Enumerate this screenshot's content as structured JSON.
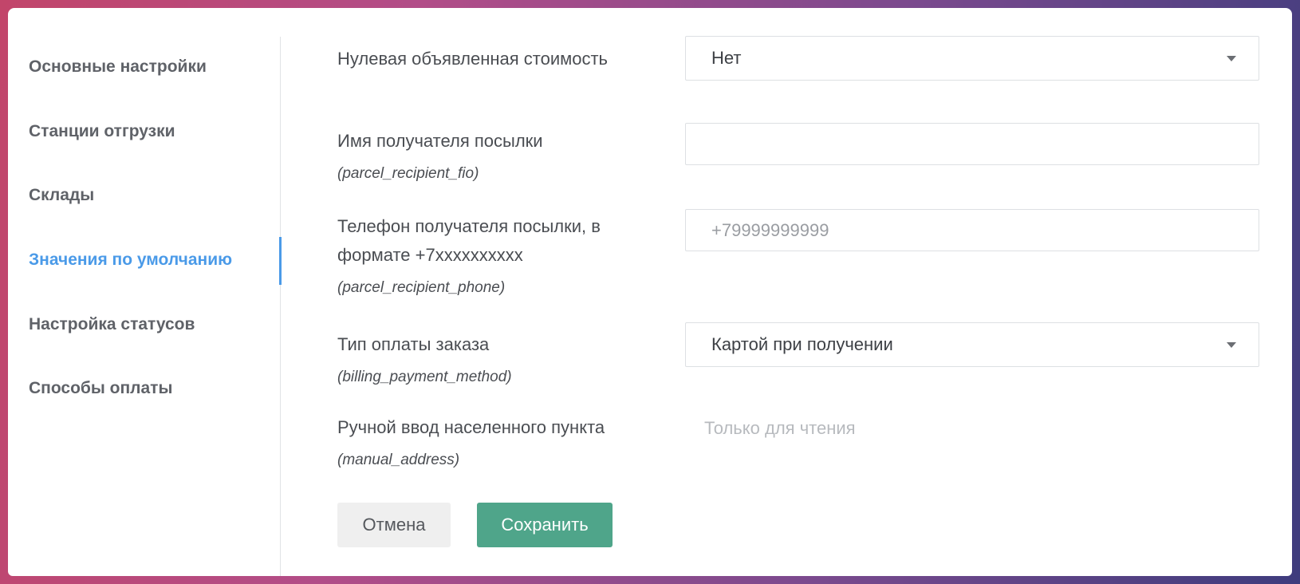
{
  "sidebar": {
    "items": [
      {
        "label": "Основные настройки"
      },
      {
        "label": "Станции отгрузки"
      },
      {
        "label": "Склады"
      },
      {
        "label": "Значения по умолчанию"
      },
      {
        "label": "Настройка статусов"
      },
      {
        "label": "Способы оплаты"
      }
    ],
    "active_index": 3
  },
  "form": {
    "zero_declared_value": {
      "label": "Нулевая объявленная стоимость",
      "value": "Нет"
    },
    "recipient_name": {
      "label": "Имя получателя посылки",
      "key": "(parcel_recipient_fio)",
      "value": "",
      "placeholder": ""
    },
    "recipient_phone": {
      "label_line1": "Телефон получателя посылки, в",
      "label_line2": "формате +7xxxxxxxxxx",
      "key": "(parcel_recipient_phone)",
      "value": "",
      "placeholder": "+79999999999"
    },
    "payment_method": {
      "label": "Тип оплаты заказа",
      "key": "(billing_payment_method)",
      "value": "Картой при получении"
    },
    "manual_address": {
      "label": "Ручной ввод населенного пункта",
      "key": "(manual_address)",
      "value": "Только для чтения"
    }
  },
  "buttons": {
    "cancel": "Отмена",
    "save": "Сохранить"
  },
  "colors": {
    "accent": "#4a9ae8",
    "save_button": "#4fa58a",
    "cancel_button": "#efefef"
  },
  "icons": {
    "dropdown": "chevron-down-icon"
  }
}
